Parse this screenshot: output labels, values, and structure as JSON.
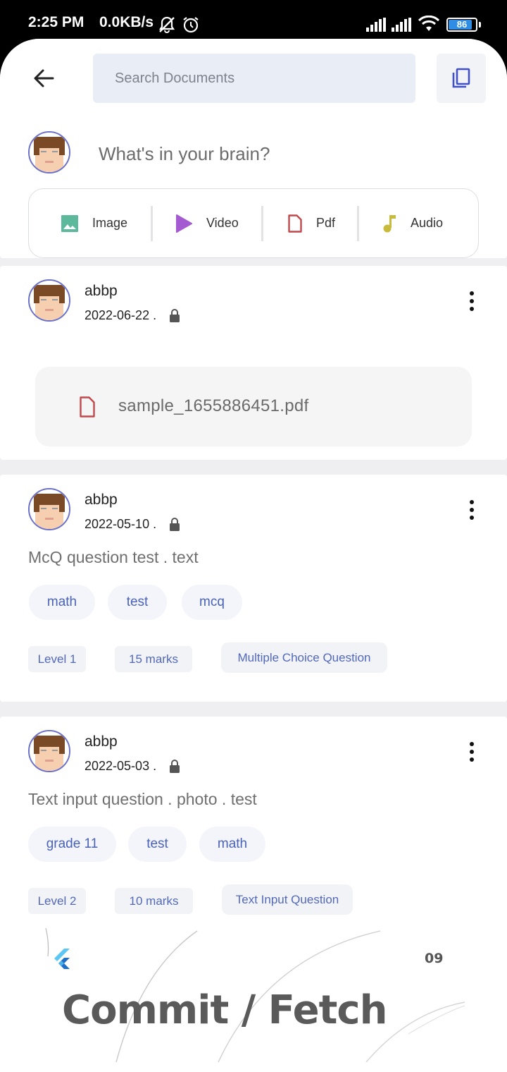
{
  "status_bar": {
    "time": "2:25 PM",
    "net_speed": "0.0KB/s",
    "battery": "86",
    "battery_level_percent": 86
  },
  "appbar": {
    "search_placeholder": "Search Documents"
  },
  "composer": {
    "prompt": "What's in your brain?",
    "media": [
      {
        "label": "Image",
        "icon": "image-icon",
        "color": "#5cb99b"
      },
      {
        "label": "Video",
        "icon": "play-icon",
        "color": "#a45ad0"
      },
      {
        "label": "Pdf",
        "icon": "file-icon",
        "color": "#c0484c"
      },
      {
        "label": "Audio",
        "icon": "music-note-icon",
        "color": "#c8bb3c"
      }
    ]
  },
  "posts": [
    {
      "author": "abbp",
      "date": "2022-06-22 .",
      "attachment": "sample_1655886451.pdf"
    },
    {
      "author": "abbp",
      "date": "2022-05-10 .",
      "text": "McQ question test . text",
      "tags": [
        "math",
        "test",
        "mcq"
      ],
      "chips": [
        "Level 1",
        "15 marks",
        "Multiple Choice Question"
      ]
    },
    {
      "author": "abbp",
      "date": "2022-05-03 .",
      "text": "Text input question . photo . test",
      "tags": [
        "grade 11",
        "test",
        "math"
      ],
      "chips": [
        "Level 2",
        "10 marks",
        "Text Input Question"
      ]
    }
  ],
  "watermark": {
    "title": "Commit / Fetch",
    "number": "09"
  },
  "colors": {
    "accent": "#4a63b8",
    "search_bg": "#e9edf6",
    "background": "#efeff1"
  }
}
